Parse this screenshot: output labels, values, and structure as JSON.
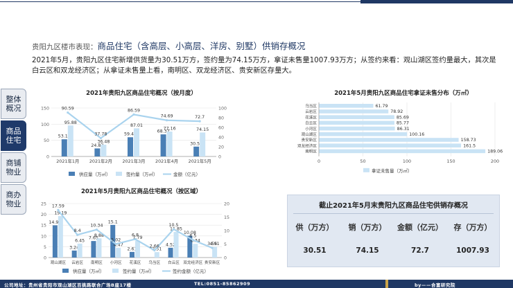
{
  "header": {
    "title_prefix": "贵阳九区楼市表现：",
    "title_main": "商品住宅（含高层、小高层、洋房、别墅）供销存概况",
    "summary": "2021年5月，贵阳九区住宅新增供货量为30.51万方，签约量为74.15万方，拿证未售量1007.93万方；从签约来看：观山湖区签约量最大，其次是白云区和双龙经济区；从拿证未售量上看，南明区、双龙经济区、贵安新区存量大。"
  },
  "sidebar": {
    "items": [
      {
        "label": "整体概况",
        "active": false
      },
      {
        "label": "商品住宅",
        "active": true
      },
      {
        "label": "商铺物业",
        "active": false
      },
      {
        "label": "商办物业",
        "active": false
      }
    ]
  },
  "colors": {
    "navy": "#1f3864",
    "bar_dark": "#4a7fb5",
    "bar_light": "#c9e3f5",
    "line": "#a9d3ee",
    "gold": "#c9a44a"
  },
  "chart_data": [
    {
      "type": "bar",
      "title": "2021年贵阳九区商品住宅概况（按月度）",
      "categories": [
        "2021年1月",
        "2021年2月",
        "2021年3月",
        "2021年4月",
        "2021年5月"
      ],
      "series": [
        {
          "name": "供应量（万㎡）",
          "kind": "bar",
          "axis": "left",
          "values": [
            53.18,
            24.83,
            59.48,
            68.37,
            30.51
          ]
        },
        {
          "name": "签约量（万㎡）",
          "kind": "bar",
          "axis": "left",
          "values": [
            95.88,
            36.48,
            87.01,
            77.16,
            74.15
          ]
        },
        {
          "name": "金额（亿元）",
          "kind": "line",
          "axis": "right",
          "values": [
            90.59,
            37.78,
            86.59,
            74.69,
            72.7
          ]
        }
      ],
      "ylim_left": [
        0,
        150
      ],
      "yticks_left": [
        0,
        50,
        100,
        150
      ],
      "ylim_right": [
        0,
        100
      ],
      "yticks_right": [
        0,
        20,
        40,
        60,
        80,
        100
      ],
      "legend": "bottom"
    },
    {
      "type": "bar",
      "orientation": "horizontal",
      "title": "2021年5月贵阳九区商品住宅拿证未售分布（万㎡）",
      "categories": [
        "乌当区",
        "云岩区",
        "花溪区",
        "白云区",
        "小河区",
        "观山湖区",
        "贵安新区",
        "双龙经济区",
        "南明区"
      ],
      "series": [
        {
          "name": "拿证未售量（万㎡）",
          "values": [
            61.79,
            78.92,
            85.69,
            85.77,
            86.31,
            100.16,
            158.73,
            161.5,
            189.06
          ]
        }
      ],
      "xlim": [
        0,
        200
      ],
      "xticks": [
        0,
        50,
        100,
        150,
        200
      ],
      "legend": "bottom"
    },
    {
      "type": "bar",
      "title": "2021年5月贵阳九区商品住宅概况（按区域）",
      "categories": [
        "观山湖区",
        "云岩区",
        "南明区",
        "小河区",
        "花溪区",
        "乌当区",
        "白云区",
        "双龙经济区",
        "贵安新区"
      ],
      "series": [
        {
          "name": "供应量（万㎡）",
          "kind": "bar",
          "axis": "left",
          "values": [
            14.91,
            3.24,
            7.65,
            15.1,
            2.61,
            0,
            4.52,
            10.08,
            0
          ]
        },
        {
          "name": "签约量（万㎡）",
          "kind": "bar",
          "axis": "left",
          "values": [
            19.19,
            6.45,
            8.88,
            4.47,
            7.79,
            2.51,
            11.85,
            6.34,
            4.91
          ]
        },
        {
          "name": "签约金额（亿元）",
          "kind": "line",
          "axis": "right",
          "values": [
            17.59,
            8.4,
            10.34,
            5.02,
            6.8,
            2.66,
            10.5,
            6.5,
            3.55
          ]
        }
      ],
      "ylim_left": [
        0,
        25
      ],
      "yticks_left": [
        0,
        5,
        10,
        15,
        20,
        25
      ],
      "ylim_right": [
        0,
        20
      ],
      "yticks_right": [
        0,
        5,
        10,
        15,
        20
      ],
      "legend": "bottom"
    }
  ],
  "summary_card": {
    "title": "截止2021年5月末贵阳九区商品住宅供销存概况",
    "columns": [
      {
        "label": "供（万方）",
        "value": "30.51"
      },
      {
        "label": "销（万方）",
        "value": "74.15"
      },
      {
        "label": "金额（亿元）",
        "value": "72.7"
      },
      {
        "label": "存（万方）",
        "value": "1007.93"
      }
    ]
  },
  "footer": {
    "address": "公司地址：贵州省贵阳市观山湖区百挑路联合广场B座17楼",
    "tel": "TEL:0851-85862909",
    "by": "by——合富研究院"
  }
}
